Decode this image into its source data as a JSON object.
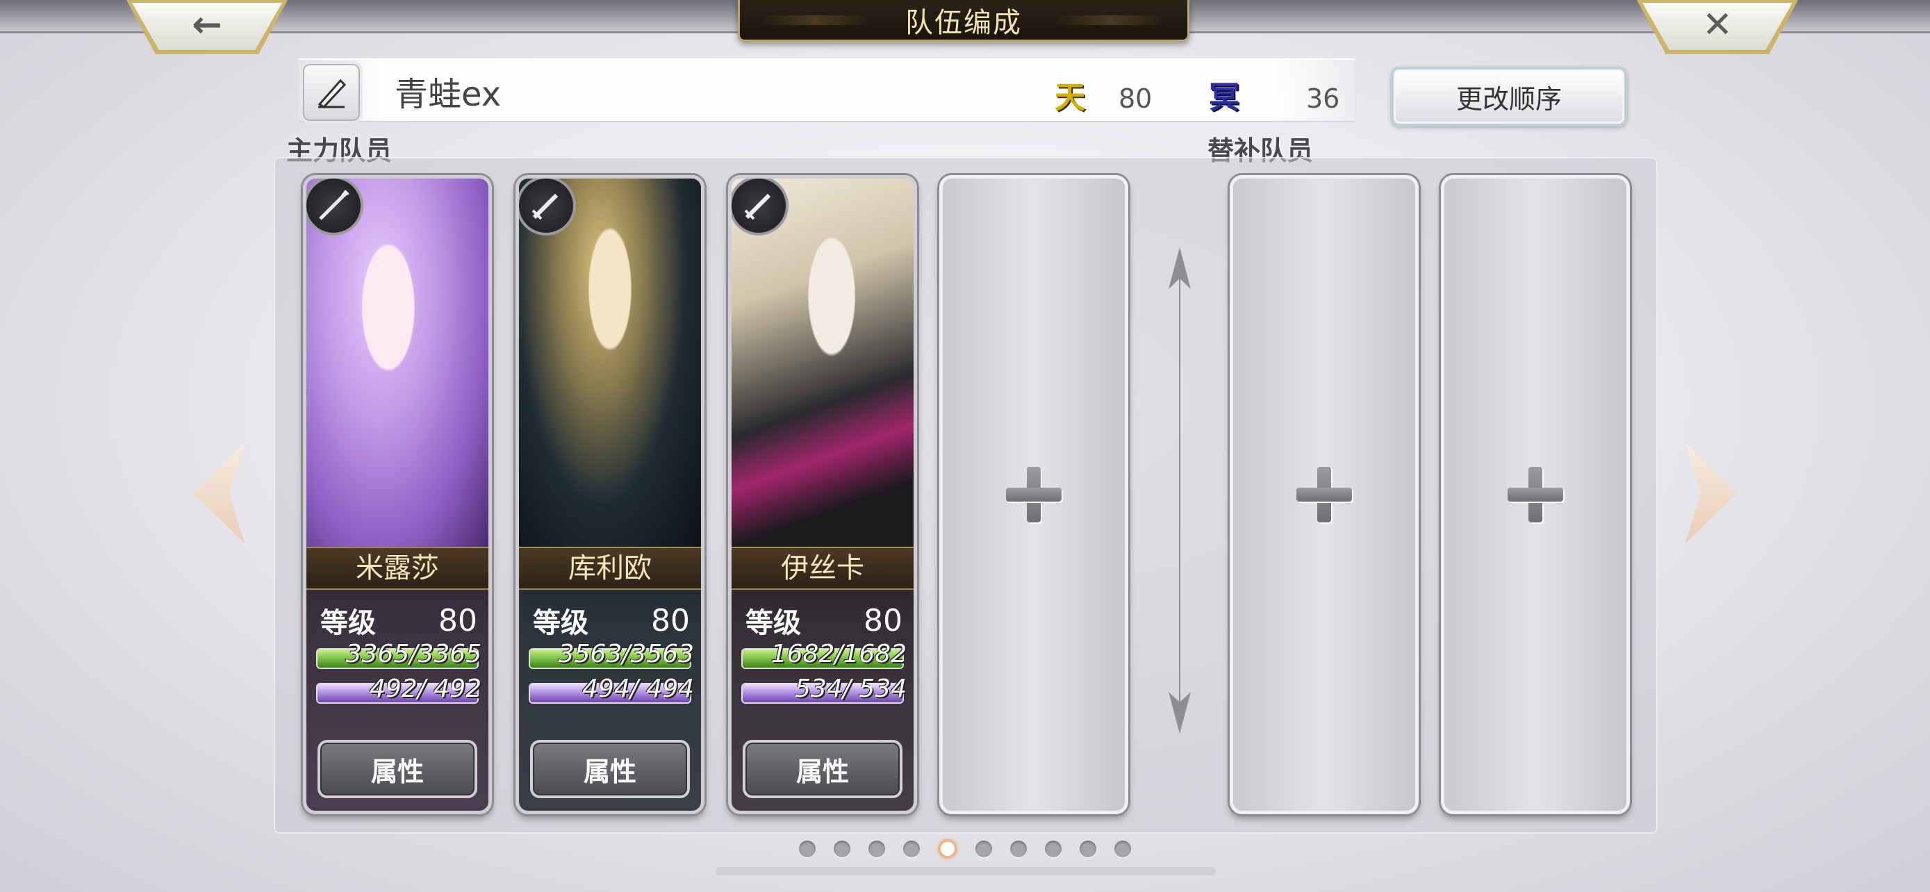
{
  "header": {
    "title": "队伍编成",
    "back_icon": "arrow-left-icon",
    "close_icon": "close-icon"
  },
  "party": {
    "name": "青蛙ex",
    "ten_label": "天",
    "ten_value": "80",
    "mei_label": "冥",
    "mei_value": "36",
    "change_order_label": "更改顺序"
  },
  "sections": {
    "main_label": "主力队员",
    "sub_label": "替补队员"
  },
  "members": [
    {
      "name": "米露莎",
      "level_label": "等级",
      "level": "80",
      "hp": "3365/3365",
      "mp": " 492/  492",
      "hp_ratio": 1.0,
      "mp_ratio": 1.0,
      "weapon": "spear-icon",
      "attr_label": "属性"
    },
    {
      "name": "库利欧",
      "level_label": "等级",
      "level": "80",
      "hp": "3563/3563",
      "mp": " 494/  494",
      "hp_ratio": 1.0,
      "mp_ratio": 1.0,
      "weapon": "sword-icon",
      "attr_label": "属性"
    },
    {
      "name": "伊丝卡",
      "level_label": "等级",
      "level": "80",
      "hp": "1682/1682",
      "mp": " 534/  534",
      "hp_ratio": 1.0,
      "mp_ratio": 1.0,
      "weapon": "sword-icon",
      "attr_label": "属性"
    }
  ],
  "empty_slot_icon": "plus-icon",
  "pagination": {
    "total": 10,
    "current": 5
  },
  "colors": {
    "title_text": "#f2e3b3",
    "name_plate": "#4b3a25",
    "hp_bar": "#6fb43a",
    "mp_bar": "#a07bd8",
    "active_dot_ring": "#e9b68d"
  }
}
